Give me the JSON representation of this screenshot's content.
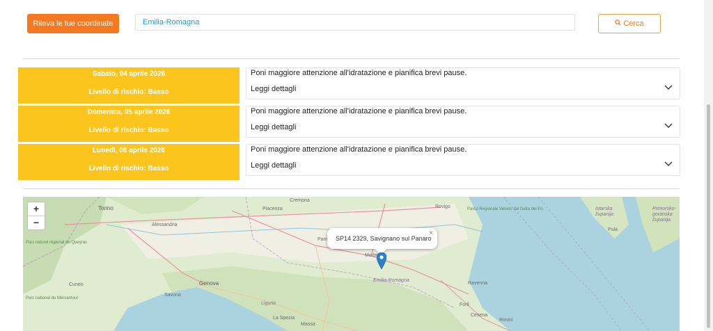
{
  "toolbar": {
    "locate_label": "Rileva le tue coordinate",
    "search_value": "Emilia-Romagna",
    "search_label": "Cerca",
    "search_icon": "magnifier-icon"
  },
  "forecast": [
    {
      "date": "Sabato, 04 aprile 2026",
      "risk": "Livello di rischio: Basso",
      "advice": "Poni maggiore attenzione all'idratazione e pianifica brevi pause.",
      "details": "Leggi dettagli"
    },
    {
      "date": "Domenica, 05 aprile 2026",
      "risk": "Livello di rischio: Basso",
      "advice": "Poni maggiore attenzione all'idratazione e pianifica brevi pause.",
      "details": "Leggi dettagli"
    },
    {
      "date": "Lunedì, 06 aprile 2026",
      "risk": "Livello di rischio: Basso",
      "advice": "Poni maggiore attenzione all'idratazione e pianifica brevi pause.",
      "details": "Leggi dettagli"
    }
  ],
  "map": {
    "zoom_in": "+",
    "zoom_out": "−",
    "popup_text": "SP14 2329, Savignano sul Panaro",
    "popup_close": "×",
    "places": {
      "torino": "Torino",
      "cremona": "Cremona",
      "piacenza": "Piacenza",
      "rovigo": "Rovigo",
      "alessandria": "Alessandria",
      "parco_po": "Parco Regionale Veneto del Delta del Po",
      "istarska": "Istarska županija",
      "primorsko": "Primorsko-goranska županija",
      "pula": "Pula",
      "parco_queyras": "Parc naturel régional du Queyras",
      "modena": "Modena",
      "parma": "Parma",
      "emilia": "Emilia-Romagna",
      "cuneo": "Cuneo",
      "genova": "Genova",
      "savona": "Savona",
      "ravenna": "Ravenna",
      "parco_mercantour": "Parc national du Mercantour",
      "liguria": "Liguria",
      "la_spezia": "La Spezia",
      "forli": "Forlì",
      "massa": "Massa",
      "rimini": "Rimini",
      "cesena": "Cesena"
    }
  },
  "colors": {
    "accent": "#f47920",
    "risk_low": "#fbc51e",
    "search_text": "#1a9fd6",
    "marker": "#2a81cb"
  }
}
